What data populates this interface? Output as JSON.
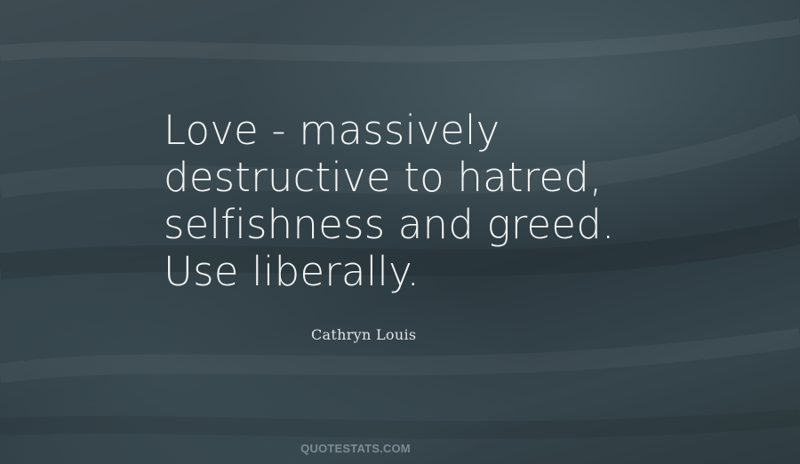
{
  "quote": {
    "text": "Love - massively\ndestructive to hatred,\nselfishness and greed.\nUse liberally."
  },
  "author": {
    "name": "Cathryn Louis"
  },
  "watermark": {
    "text": "QUOTESTATS.COM"
  },
  "colors": {
    "text": "#f2f4f4",
    "background": "#34444a"
  }
}
